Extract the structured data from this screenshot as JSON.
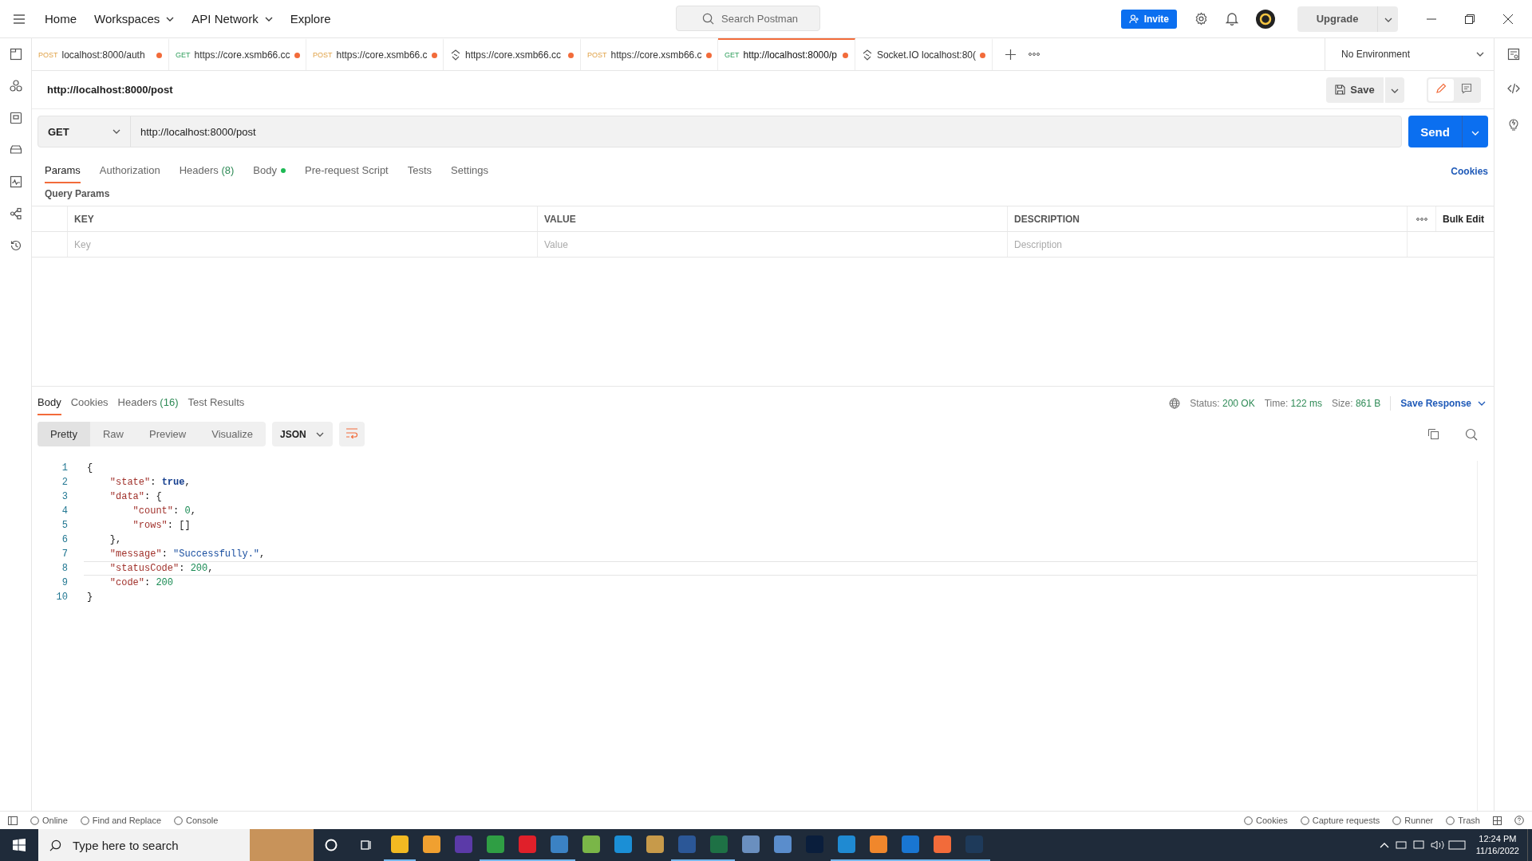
{
  "top_nav": {
    "items": [
      {
        "label": "Home",
        "dropdown": false
      },
      {
        "label": "Workspaces",
        "dropdown": true
      },
      {
        "label": "API Network",
        "dropdown": true
      },
      {
        "label": "Explore",
        "dropdown": false
      }
    ],
    "search": {
      "placeholder": "Search Postman"
    },
    "invite": "Invite",
    "upgrade": "Upgrade"
  },
  "tabs": [
    {
      "kind": "http",
      "method": "POST",
      "label": "localhost:8000/auth",
      "selected": false,
      "unsaved": true
    },
    {
      "kind": "http",
      "method": "GET",
      "label": "https://core.xsmb66.cc",
      "selected": false,
      "unsaved": true
    },
    {
      "kind": "http",
      "method": "POST",
      "label": "https://core.xsmb66.c",
      "selected": false,
      "unsaved": true
    },
    {
      "kind": "socket",
      "label": "https://core.xsmb66.cc",
      "selected": false,
      "unsaved": true
    },
    {
      "kind": "http",
      "method": "POST",
      "label": "https://core.xsmb66.c",
      "selected": false,
      "unsaved": true
    },
    {
      "kind": "http",
      "method": "GET",
      "label": "http://localhost:8000/p",
      "selected": true,
      "unsaved": true
    },
    {
      "kind": "socket",
      "label": "Socket.IO localhost:80(",
      "selected": false,
      "unsaved": true
    }
  ],
  "environment": "No Environment",
  "request": {
    "title": "http://localhost:8000/post",
    "save": "Save",
    "method": "GET",
    "url": "http://localhost:8000/post",
    "send": "Send",
    "tabs": [
      {
        "label": "Params",
        "selected": true
      },
      {
        "label": "Authorization",
        "selected": false
      },
      {
        "label": "Headers",
        "count": "(8)",
        "selected": false
      },
      {
        "label": "Body",
        "dot": true,
        "selected": false
      },
      {
        "label": "Pre-request Script",
        "selected": false
      },
      {
        "label": "Tests",
        "selected": false
      },
      {
        "label": "Settings",
        "selected": false
      }
    ],
    "cookies": "Cookies",
    "query_params_title": "Query Params",
    "table": {
      "columns": [
        "KEY",
        "VALUE",
        "DESCRIPTION"
      ],
      "bulk_edit": "Bulk Edit",
      "placeholders": [
        "Key",
        "Value",
        "Description"
      ]
    }
  },
  "response": {
    "tabs": [
      {
        "label": "Body",
        "selected": true
      },
      {
        "label": "Cookies",
        "selected": false
      },
      {
        "label": "Headers",
        "count": "(16)",
        "selected": false
      },
      {
        "label": "Test Results",
        "selected": false
      }
    ],
    "meta": [
      {
        "label": "Status:",
        "value": "200 OK"
      },
      {
        "label": "Time:",
        "value": "122 ms"
      },
      {
        "label": "Size:",
        "value": "861 B"
      }
    ],
    "save_response": "Save Response",
    "views": [
      {
        "label": "Pretty",
        "selected": true
      },
      {
        "label": "Raw",
        "selected": false
      },
      {
        "label": "Preview",
        "selected": false
      },
      {
        "label": "Visualize",
        "selected": false
      }
    ],
    "format": "JSON",
    "lines": [
      {
        "number": "1",
        "selected": false,
        "tokens": [
          {
            "kind": "punct",
            "text": "{"
          }
        ]
      },
      {
        "number": "2",
        "selected": false,
        "tokens": [
          {
            "kind": "key",
            "text": "    \"state\""
          },
          {
            "kind": "punct",
            "text": ": "
          },
          {
            "kind": "bool",
            "text": "true"
          },
          {
            "kind": "punct",
            "text": ","
          }
        ]
      },
      {
        "number": "3",
        "selected": false,
        "tokens": [
          {
            "kind": "key",
            "text": "    \"data\""
          },
          {
            "kind": "punct",
            "text": ": {"
          }
        ]
      },
      {
        "number": "4",
        "selected": false,
        "tokens": [
          {
            "kind": "key",
            "text": "        \"count\""
          },
          {
            "kind": "punct",
            "text": ": "
          },
          {
            "kind": "number",
            "text": "0"
          },
          {
            "kind": "punct",
            "text": ","
          }
        ]
      },
      {
        "number": "5",
        "selected": false,
        "tokens": [
          {
            "kind": "key",
            "text": "        \"rows\""
          },
          {
            "kind": "punct",
            "text": ": []"
          }
        ]
      },
      {
        "number": "6",
        "selected": false,
        "tokens": [
          {
            "kind": "punct",
            "text": "    },"
          }
        ]
      },
      {
        "number": "7",
        "selected": false,
        "tokens": [
          {
            "kind": "key",
            "text": "    \"message\""
          },
          {
            "kind": "punct",
            "text": ": "
          },
          {
            "kind": "string",
            "text": "\"Successfully.\""
          },
          {
            "kind": "punct",
            "text": ","
          }
        ]
      },
      {
        "number": "8",
        "selected": true,
        "tokens": [
          {
            "kind": "key",
            "text": "    \"statusCode\""
          },
          {
            "kind": "punct",
            "text": ": "
          },
          {
            "kind": "number",
            "text": "200"
          },
          {
            "kind": "punct",
            "text": ","
          }
        ]
      },
      {
        "number": "9",
        "selected": false,
        "tokens": [
          {
            "kind": "key",
            "text": "    \"code\""
          },
          {
            "kind": "punct",
            "text": ": "
          },
          {
            "kind": "number",
            "text": "200"
          }
        ]
      },
      {
        "number": "10",
        "selected": false,
        "tokens": [
          {
            "kind": "punct",
            "text": "}"
          }
        ]
      }
    ]
  },
  "status_bar": {
    "left": [
      "Online",
      "Find and Replace",
      "Console"
    ],
    "right": [
      "Cookies",
      "Capture requests",
      "Runner",
      "Trash"
    ]
  },
  "taskbar": {
    "search_placeholder": "Type here to search",
    "time": "12:24 PM",
    "date": "11/16/2022",
    "apps": [
      {
        "color": "#f2b922",
        "running": true
      },
      {
        "color": "#f0a030",
        "running": false
      },
      {
        "color": "#5b3aa8",
        "running": false
      },
      {
        "color": "#2f9e44",
        "running": true
      },
      {
        "color": "#e0202a",
        "running": true
      },
      {
        "color": "#3b82c4",
        "running": true
      },
      {
        "color": "#7ab648",
        "running": false
      },
      {
        "color": "#1b8fd6",
        "running": false
      },
      {
        "color": "#c79a4a",
        "running": false
      },
      {
        "color": "#2b5797",
        "running": true
      },
      {
        "color": "#1e7145",
        "running": true
      },
      {
        "color": "#6a8fbf",
        "running": false
      },
      {
        "color": "#5a8dcc",
        "running": false
      },
      {
        "color": "#0a1e3c",
        "running": false
      },
      {
        "color": "#1f8ad2",
        "running": true
      },
      {
        "color": "#f0872c",
        "running": true
      },
      {
        "color": "#1976d2",
        "running": true
      },
      {
        "color": "#f26b3a",
        "running": true
      },
      {
        "color": "#1e3a5a",
        "running": true
      }
    ]
  }
}
